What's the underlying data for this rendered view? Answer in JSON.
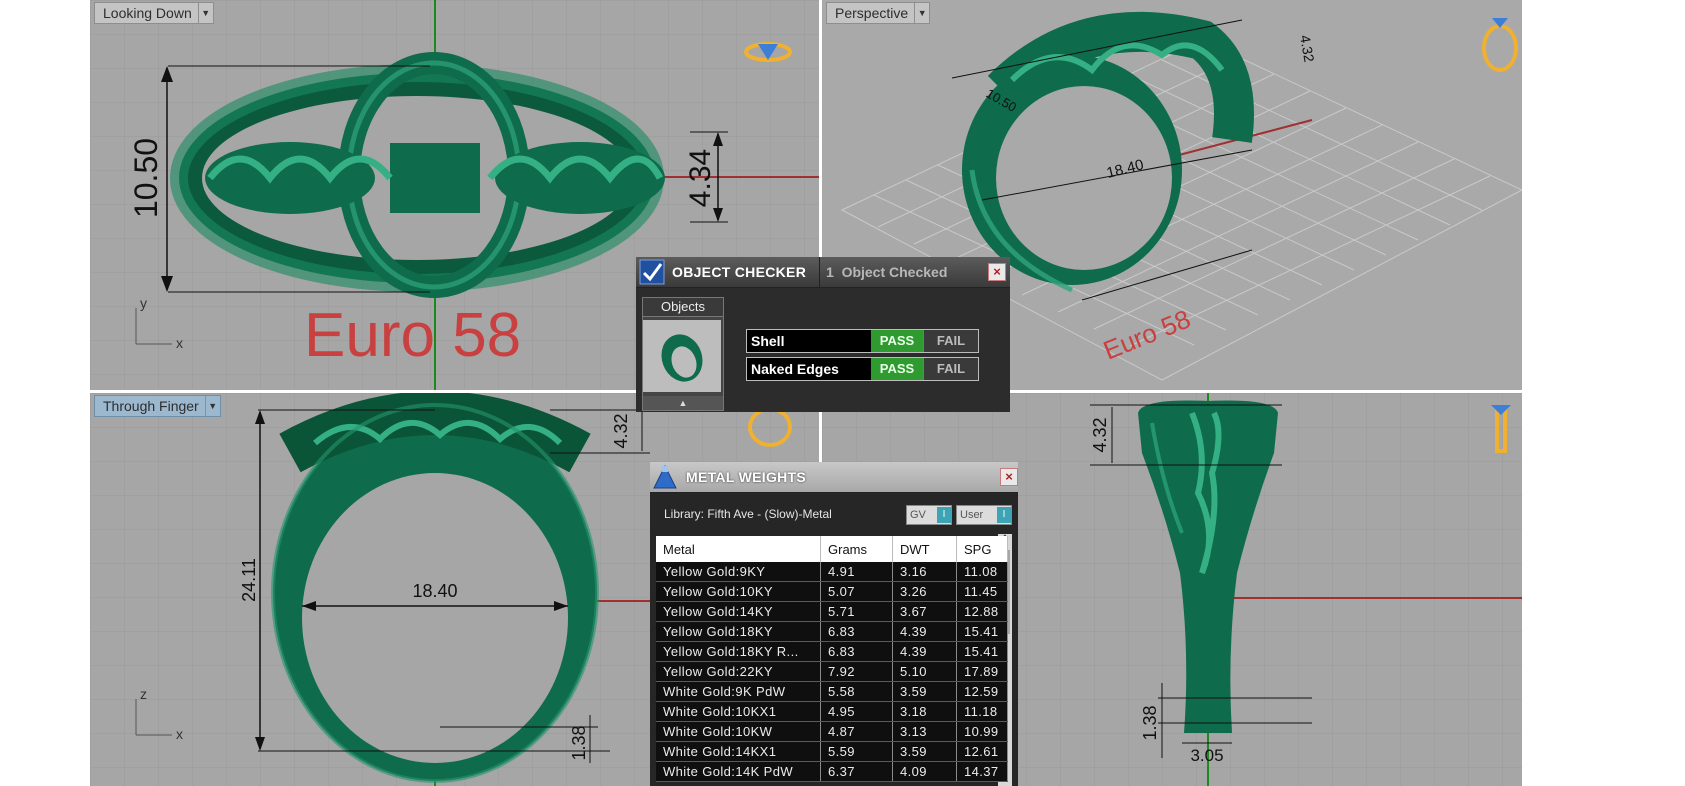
{
  "viewports": {
    "top_left": {
      "label": "Looking Down",
      "dim_vertical": "10.50",
      "dim_right": "4.34",
      "watermark": "Euro 58",
      "axis_y": "y",
      "axis_x": "x"
    },
    "top_right": {
      "label": "Perspective",
      "dim_top": "4.32",
      "dim_left": "10.50",
      "dim_center": "18.40",
      "watermark": "Euro 58"
    },
    "bottom_left": {
      "label": "Through Finger",
      "dim_height": "24.11",
      "dim_width": "18.40",
      "dim_top": "4.32",
      "dim_bottom": "1.38",
      "axis_z": "z",
      "axis_x": "x"
    },
    "bottom_right": {
      "dim_top": "4.32",
      "dim_bottom": "1.38",
      "dim_width": "3.05"
    }
  },
  "object_checker": {
    "title": "OBJECT CHECKER",
    "status": "1  Object Checked",
    "objects_label": "Objects",
    "checks": [
      {
        "label": "Shell",
        "pass": "PASS",
        "fail": "FAIL"
      },
      {
        "label": "Naked Edges",
        "pass": "PASS",
        "fail": "FAIL"
      }
    ]
  },
  "metal_weights": {
    "title": "METAL WEIGHTS",
    "library": "Library: Fifth Ave - (Slow)-Metal",
    "toggle_gv": "GV",
    "toggle_user": "User",
    "columns": [
      "Metal",
      "Grams",
      "DWT",
      "SPG"
    ],
    "rows": [
      [
        "Yellow Gold:9KY",
        "4.91",
        "3.16",
        "11.08"
      ],
      [
        "Yellow Gold:10KY",
        "5.07",
        "3.26",
        "11.45"
      ],
      [
        "Yellow Gold:14KY",
        "5.71",
        "3.67",
        "12.88"
      ],
      [
        "Yellow Gold:18KY",
        "6.83",
        "4.39",
        "15.41"
      ],
      [
        "Yellow Gold:18KY R...",
        "6.83",
        "4.39",
        "15.41"
      ],
      [
        "Yellow Gold:22KY",
        "7.92",
        "5.10",
        "17.89"
      ],
      [
        "White Gold:9K PdW",
        "5.58",
        "3.59",
        "12.59"
      ],
      [
        "White Gold:10KX1",
        "4.95",
        "3.18",
        "11.18"
      ],
      [
        "White Gold:10KW",
        "4.87",
        "3.13",
        "10.99"
      ],
      [
        "White Gold:14KX1",
        "5.59",
        "3.59",
        "12.61"
      ],
      [
        "White Gold:14K PdW",
        "6.37",
        "4.09",
        "14.37"
      ]
    ]
  },
  "colors": {
    "model": "#0e6b4c",
    "grid_bg": "#a6a6a6",
    "pass": "#2f9a2f",
    "watermark": "#c84040",
    "gizmo": "#f0b030"
  }
}
